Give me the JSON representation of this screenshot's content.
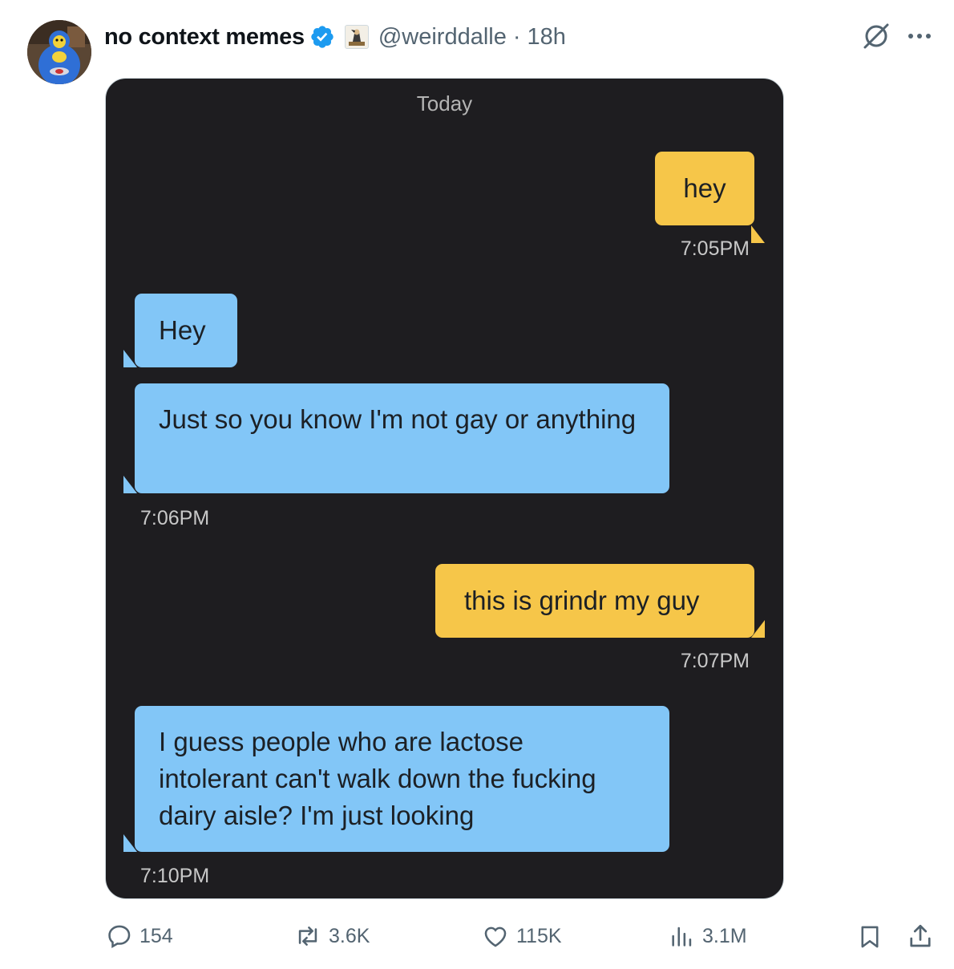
{
  "post": {
    "display_name": "no context memes",
    "handle": "@weirddalle",
    "separator": "·",
    "time": "18h"
  },
  "icons": {
    "verified": "verified-badge-icon",
    "affiliate": "affiliate-badge-icon",
    "grok": "grok-icon",
    "more": "more-icon",
    "reply": "reply-icon",
    "repost": "repost-icon",
    "like": "like-icon",
    "views": "views-icon",
    "bookmark": "bookmark-icon",
    "share": "share-icon"
  },
  "media": {
    "date_label": "Today",
    "messages": [
      {
        "text": "hey",
        "time": "7:05PM"
      },
      {
        "text": "Hey"
      },
      {
        "text": "Just so you know I'm not gay or anything",
        "time": "7:06PM"
      },
      {
        "text": "this is grindr my guy",
        "time": "7:07PM"
      },
      {
        "text": "I guess people who are lactose intolerant can't walk down the fucking dairy aisle? I'm just looking",
        "time": "7:10PM"
      }
    ]
  },
  "actions": {
    "replies": "154",
    "reposts": "3.6K",
    "likes": "115K",
    "views": "3.1M"
  },
  "colors": {
    "verified": "#1d9bf0",
    "outgoing_bubble": "#f6c649",
    "incoming_bubble": "#82c6f7",
    "chat_background": "#1e1d20",
    "muted_text": "#536471"
  }
}
